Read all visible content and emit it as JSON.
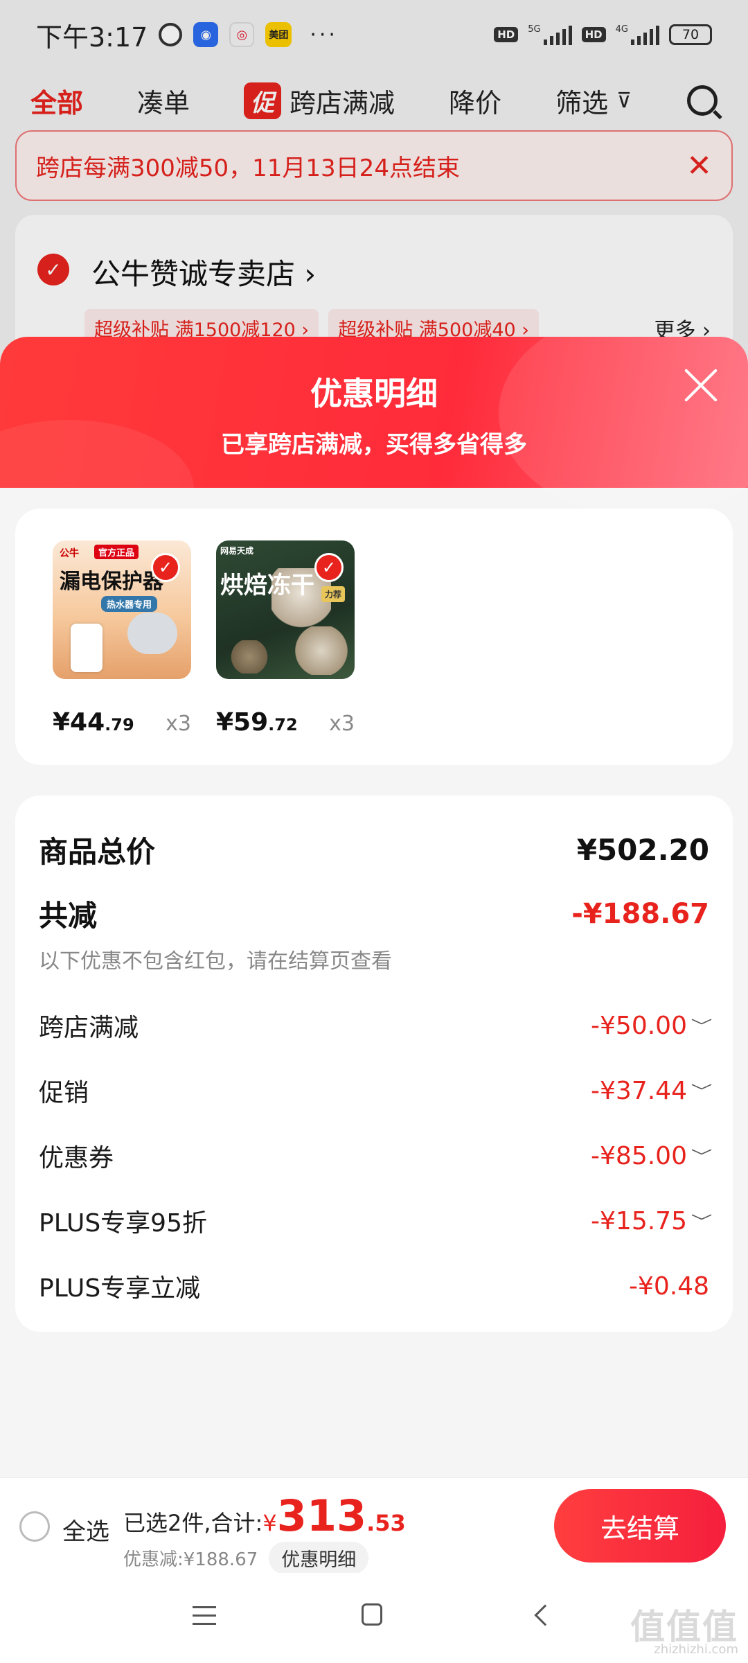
{
  "status_bar": {
    "time": "下午3:17",
    "meituan_label": "美团",
    "dots": "···",
    "hd": "HD",
    "net1": "5G",
    "net2": "4G",
    "battery": "70"
  },
  "tabs": {
    "all": "全部",
    "bundle": "凑单",
    "promo_badge": "促",
    "cross_store": "跨店满减",
    "price_drop": "降价",
    "filter": "筛选"
  },
  "notice": {
    "text": "跨店每满300减50，11月13日24点结束"
  },
  "store": {
    "name": "公牛赞诚专卖店",
    "chevron": "›",
    "chips": [
      "超级补贴 满1500减120 ›",
      "超级补贴 满500减40 ›"
    ],
    "more": "更多 ›"
  },
  "sheet": {
    "title": "优惠明细",
    "subtitle": "已享跨店满减，买得多省得多",
    "products": [
      {
        "brand": "公牛",
        "tag": "官方正品",
        "image_text": "漏电保护器",
        "pill": "热水器专用",
        "price_int": "¥44",
        "price_dec": ".79",
        "qty": "x3"
      },
      {
        "brand": "网易天成",
        "image_text": "烘焙冻干",
        "badge": "力荐",
        "price_int": "¥59",
        "price_dec": ".72",
        "qty": "x3"
      }
    ],
    "summary": {
      "total_label": "商品总价",
      "total_value": "¥502.20",
      "cut_label": "共减",
      "cut_value": "-¥188.67",
      "note": "以下优惠不包含红包，请在结算页查看",
      "items": [
        {
          "label": "跨店满减",
          "value": "-¥50.00",
          "has_chevron": true
        },
        {
          "label": "促销",
          "value": "-¥37.44",
          "has_chevron": true
        },
        {
          "label": "优惠券",
          "value": "-¥85.00",
          "has_chevron": true
        },
        {
          "label": "PLUS专享95折",
          "value": "-¥15.75",
          "has_chevron": true
        },
        {
          "label": "PLUS专享立减",
          "value": "-¥0.48",
          "has_chevron": false
        }
      ],
      "chevron": "﹀"
    }
  },
  "action_bar": {
    "select_all": "全选",
    "selected_text": "已选2件,合计:",
    "yen": "¥",
    "total_int": "313",
    "total_dec": ".53",
    "discount_text": "优惠减:¥188.67",
    "detail_chip": "优惠明细",
    "checkout": "去结算"
  },
  "watermark": {
    "text": "值值值",
    "sub": "zhizhizhi.com"
  },
  "colors": {
    "accent": "#e8231e",
    "header_gradient_start": "#ff3a3a",
    "header_gradient_end": "#ff6a7a"
  }
}
